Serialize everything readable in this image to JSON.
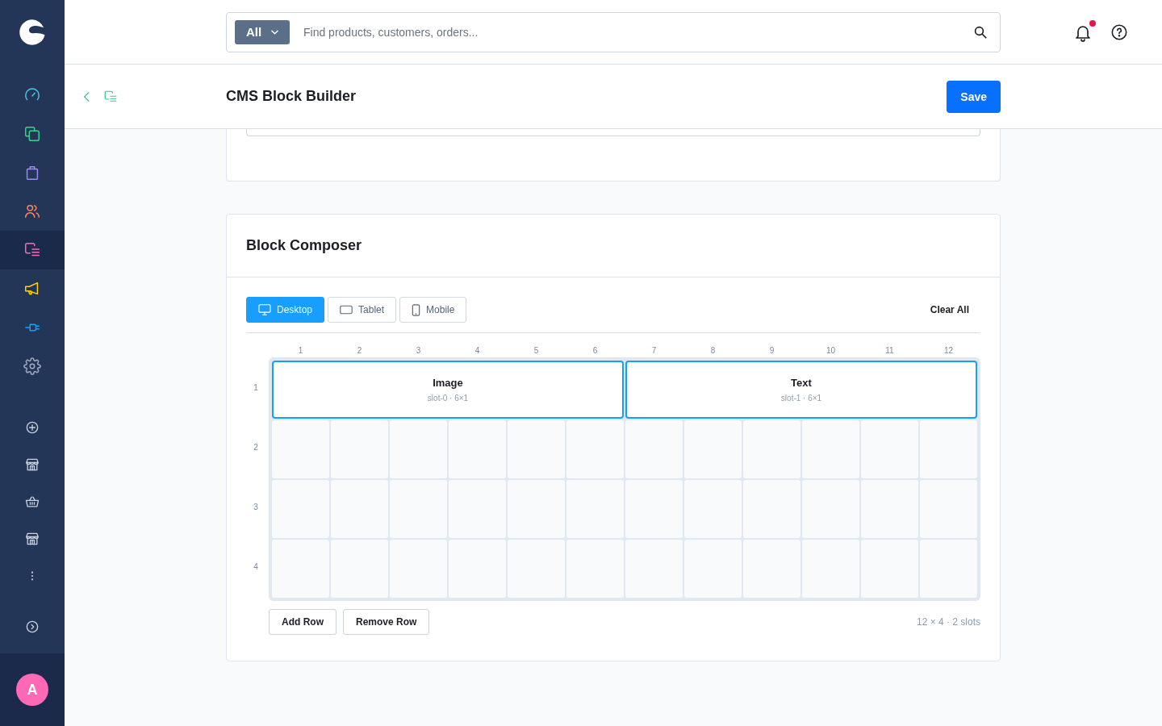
{
  "sidebar": {
    "nav": [
      {
        "selected": false,
        "color": "#4fc3e6"
      },
      {
        "selected": false,
        "color": "#3fcf8e"
      },
      {
        "selected": false,
        "color": "#9b8cf0"
      },
      {
        "selected": false,
        "color": "#ff8a5b"
      },
      {
        "selected": true,
        "color": "#ff68b4"
      },
      {
        "selected": false,
        "color": "#ffd400"
      },
      {
        "selected": false,
        "color": "#189eff"
      },
      {
        "selected": false,
        "color": "#a0acbd"
      }
    ],
    "user": {
      "initial": "A"
    }
  },
  "topbar": {
    "search": {
      "scope": "All",
      "placeholder": "Find products, customers, orders..."
    },
    "notifications": {
      "unread": true
    }
  },
  "header": {
    "title": "CMS Block Builder",
    "save": "Save"
  },
  "composer": {
    "title": "Block Composer",
    "devices": [
      {
        "label": "Desktop",
        "selected": true
      },
      {
        "label": "Tablet",
        "selected": false
      },
      {
        "label": "Mobile",
        "selected": false
      }
    ],
    "clear": "Clear All",
    "columns": [
      "1",
      "2",
      "3",
      "4",
      "5",
      "6",
      "7",
      "8",
      "9",
      "10",
      "11",
      "12"
    ],
    "rows": [
      "1",
      "2",
      "3",
      "4"
    ],
    "slots": [
      {
        "name": "Image",
        "meta": "slot-0 · 6×1"
      },
      {
        "name": "Text",
        "meta": "slot-1 · 6×1"
      }
    ],
    "actions": [
      "Add Row",
      "Remove Row"
    ],
    "summary": "12 × 4 · 2 slots"
  }
}
